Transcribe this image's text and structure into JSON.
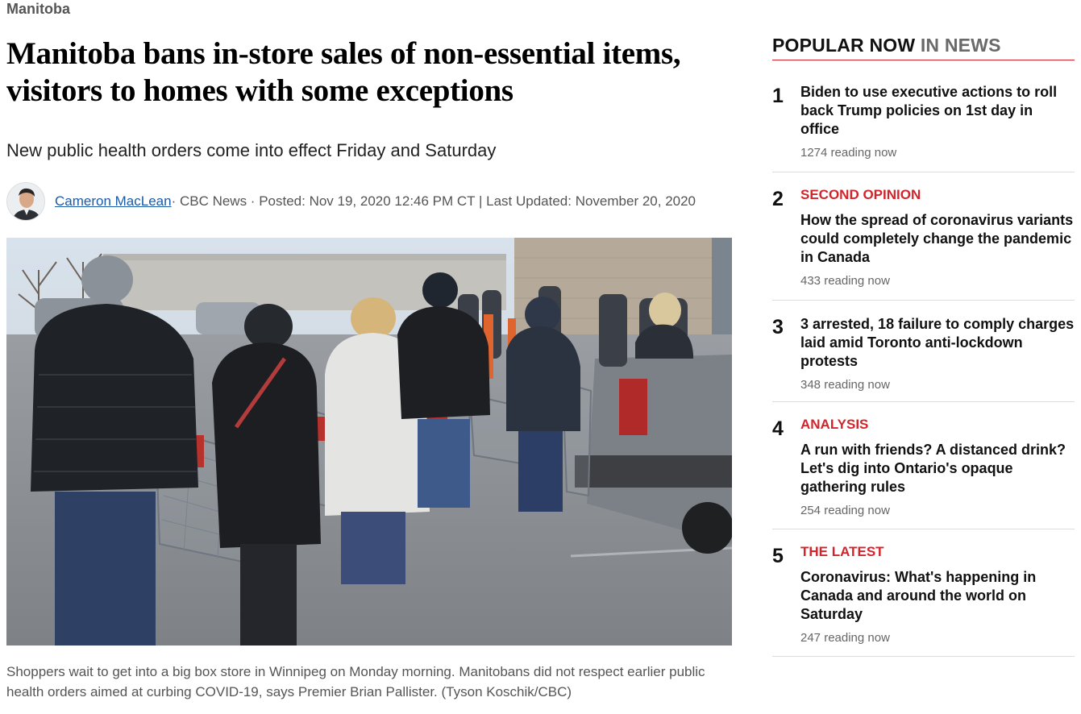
{
  "article": {
    "section": "Manitoba",
    "headline": "Manitoba bans in-store sales of non-essential items, visitors to homes with some exceptions",
    "deck": "New public health orders come into effect Friday and Saturday",
    "byline": {
      "author": "Cameron MacLean",
      "meta": " · CBC News · Posted: Nov 19, 2020 12:46 PM CT | Last Updated: November 20, 2020"
    },
    "photo_caption": "Shoppers wait to get into a big box store in Winnipeg on Monday morning. Manitobans did not respect earlier public health orders aimed at curbing COVID-19, says Premier Brian Pallister. (Tyson Koschik/CBC)"
  },
  "sidebar": {
    "title": "POPULAR NOW",
    "title_accent": " IN NEWS",
    "accent_color": "#d4242b",
    "items": [
      {
        "rank": "1",
        "label": "",
        "headline": "Biden to use executive actions to roll back Trump policies on 1st day in office",
        "count": "1274 reading now"
      },
      {
        "rank": "2",
        "label": "SECOND OPINION",
        "headline": "How the spread of coronavirus variants could completely change the pandemic in Canada",
        "count": "433 reading now"
      },
      {
        "rank": "3",
        "label": "",
        "headline": "3 arrested, 18 failure to comply charges laid amid Toronto anti-lockdown protests",
        "count": "348 reading now"
      },
      {
        "rank": "4",
        "label": "ANALYSIS",
        "headline": "A run with friends? A distanced drink? Let's dig into Ontario's opaque gathering rules",
        "count": "254 reading now"
      },
      {
        "rank": "5",
        "label": "THE LATEST",
        "headline": "Coronavirus: What's happening in Canada and around the world on Saturday",
        "count": "247 reading now"
      }
    ]
  }
}
